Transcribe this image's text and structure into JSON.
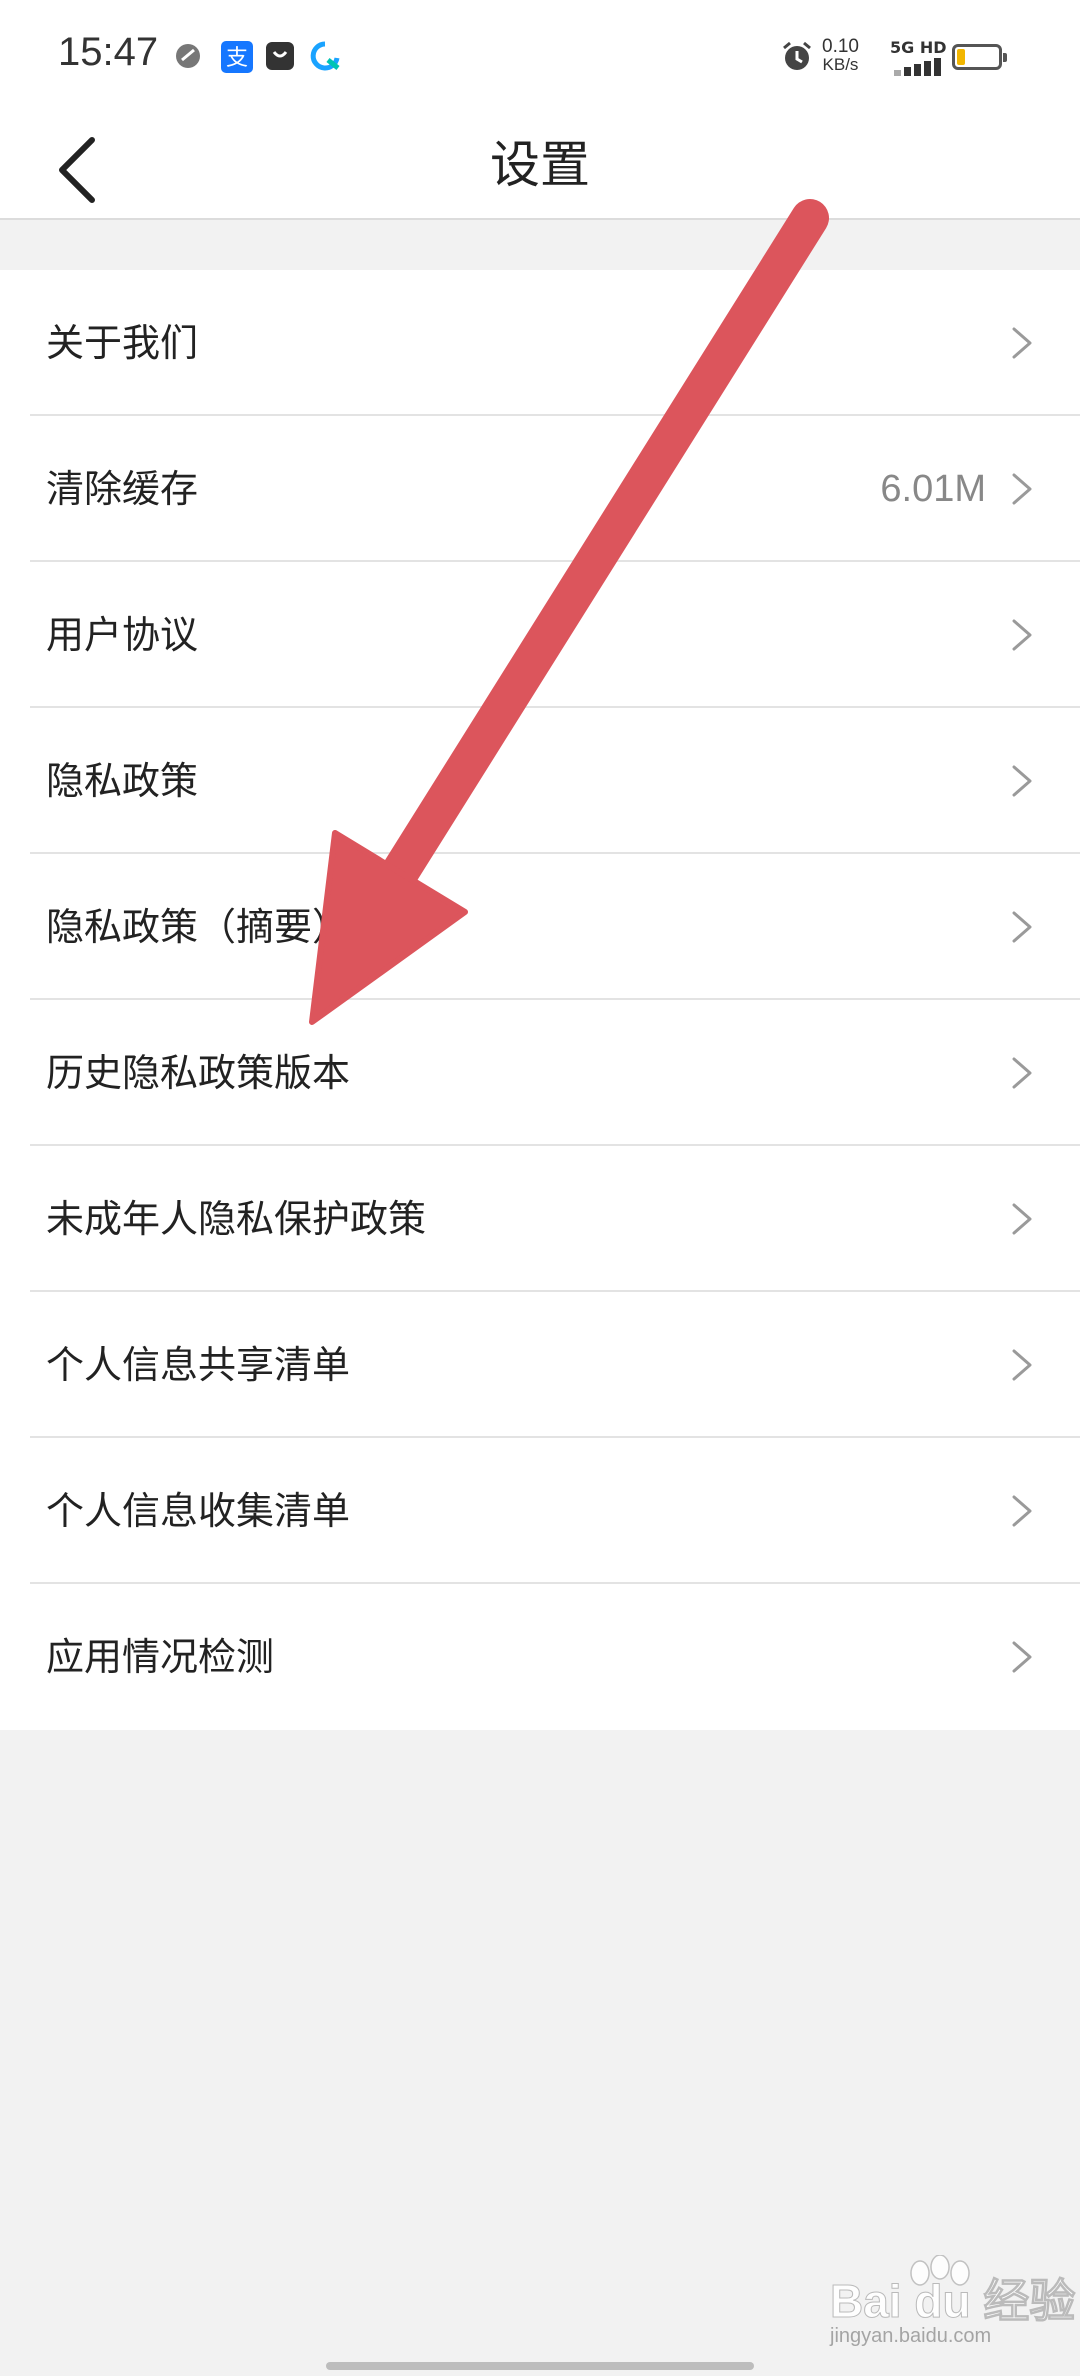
{
  "status_bar": {
    "time": "15:47",
    "net_speed_value": "0.10",
    "net_speed_unit": "KB/s",
    "network_label": "5G HD",
    "icons": [
      "app-notification-icon",
      "alipay-icon",
      "shopping-bag-icon",
      "browser-icon",
      "alarm-icon",
      "signal-icon",
      "battery-icon"
    ],
    "battery_level": 0.2
  },
  "header": {
    "title": "设置",
    "back_icon": "chevron-left-icon"
  },
  "settings": {
    "items": [
      {
        "label": "关于我们",
        "value": ""
      },
      {
        "label": "清除缓存",
        "value": "6.01M"
      },
      {
        "label": "用户协议",
        "value": ""
      },
      {
        "label": "隐私政策",
        "value": ""
      },
      {
        "label": "隐私政策（摘要）",
        "value": ""
      },
      {
        "label": "历史隐私政策版本",
        "value": ""
      },
      {
        "label": "未成年人隐私保护政策",
        "value": ""
      },
      {
        "label": "个人信息共享清单",
        "value": ""
      },
      {
        "label": "个人信息收集清单",
        "value": ""
      },
      {
        "label": "应用情况检测",
        "value": ""
      }
    ],
    "row_icon": "chevron-right-icon"
  },
  "annotation": {
    "color": "#dc555c"
  },
  "watermark": {
    "logo_text": "Bai du 经验",
    "url": "jingyan.baidu.com"
  }
}
